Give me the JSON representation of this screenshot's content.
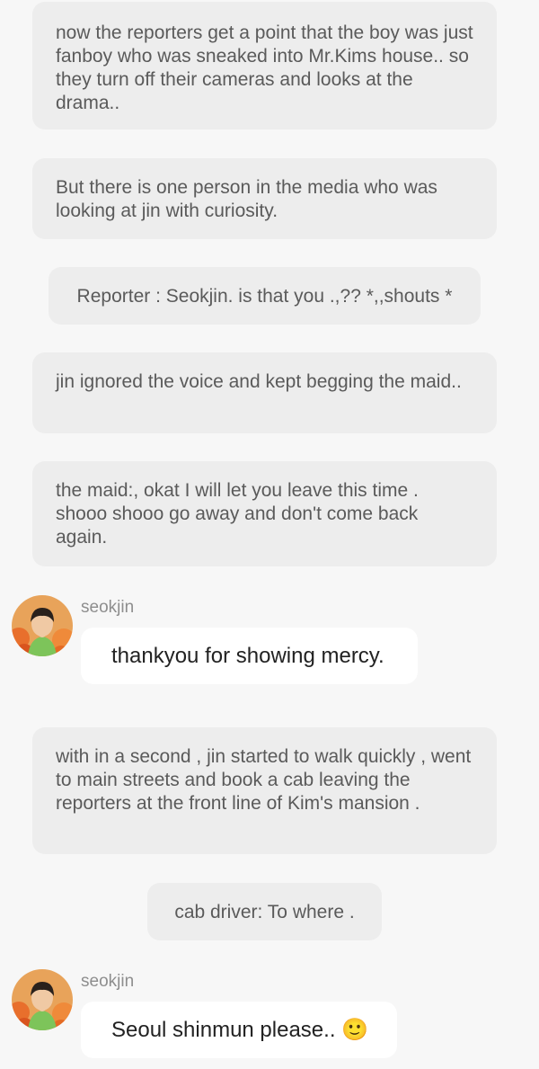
{
  "messages": [
    {
      "kind": "narration",
      "text": "now the reporters get a point that  the boy was just fanboy who was sneaked into Mr.Kims house.. so they turn off their cameras and looks at the drama.."
    },
    {
      "kind": "narration",
      "text": "But there is one person in the media who was looking at jin with curiosity."
    },
    {
      "kind": "narration",
      "text": "Reporter : Seokjin. is that you .,?? *,,shouts *"
    },
    {
      "kind": "narration",
      "text": "jin ignored the voice and kept begging the maid.."
    },
    {
      "kind": "narration",
      "text": "the maid:, okat I will let you leave this time . shooo shooo go away and don't come back again."
    },
    {
      "kind": "chat",
      "user": "seokjin",
      "text": "thankyou for showing mercy."
    },
    {
      "kind": "narration",
      "text": "with in a second , jin started to walk quickly , went to main streets and book a cab leaving the reporters at the front line of Kim's mansion ."
    },
    {
      "kind": "narration",
      "text": "cab driver: To where ."
    },
    {
      "kind": "chat",
      "user": "seokjin",
      "text": "Seoul shinmun please.. 🙂"
    }
  ],
  "colors": {
    "background": "#f7f7f7",
    "narration_bubble": "#ededed",
    "narration_text": "#5a5a5a",
    "chat_bubble": "#ffffff",
    "chat_text": "#222222",
    "username": "#8e8e8e"
  }
}
